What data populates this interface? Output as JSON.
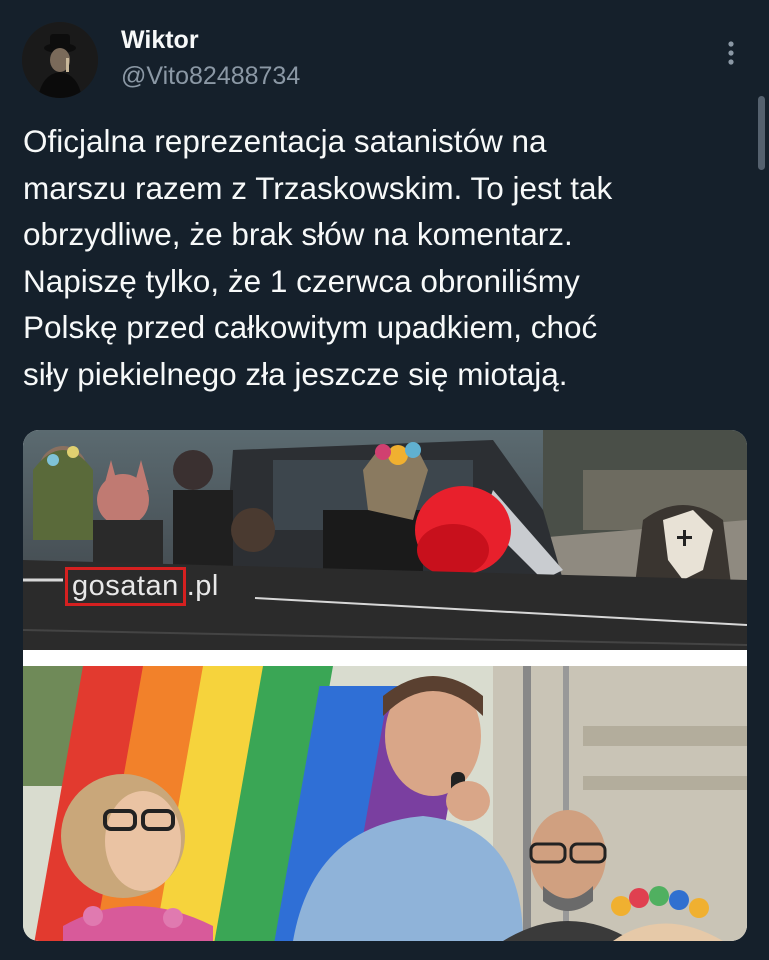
{
  "tweet": {
    "author": {
      "display_name": "Wiktor",
      "handle": "@Vito82488734"
    },
    "text": "Oficjalna reprezentacja satanistów na\nmarszu razem z Trzaskowskim. To jest tak\nobrzydliwe, że brak słów na komentarz.\nNapiszę tylko, że 1 czerwca obroniliśmy\nPolskę przed całkowitym upadkiem, choć\nsiły piekielnego zła jeszcze się miotają.",
    "more_icon": "more-vertical-icon"
  },
  "media": {
    "top_image": {
      "banner_highlight": "gosatan",
      "banner_rest": ".pl"
    },
    "bottom_image": {}
  },
  "colors": {
    "background": "#15202b",
    "text": "#f7f9f9",
    "secondary_text": "#8b98a5",
    "highlight_box": "#d52020"
  }
}
